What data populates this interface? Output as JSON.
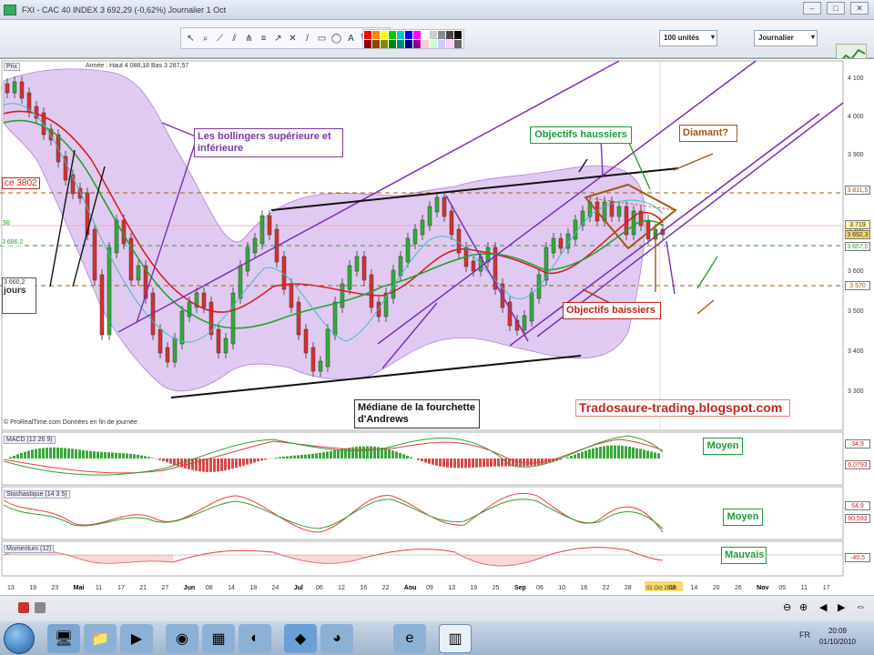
{
  "window": {
    "title": "FXI - CAC 40 INDEX    3 692,29 (-0,62%)   Journalier  1 Oct"
  },
  "toolbar": {
    "quantity_select": "100 unités",
    "period_select": "Journalier",
    "palette_colors": [
      "#ff0000",
      "#ff8800",
      "#ffff00",
      "#00cc00",
      "#00cccc",
      "#0000ff",
      "#ff00ff",
      "#ffffff",
      "#cccccc",
      "#888888",
      "#444444",
      "#000000",
      "#880000",
      "#884400",
      "#888800",
      "#008800",
      "#008888",
      "#000088",
      "#880088",
      "#ffcccc",
      "#ccffcc",
      "#ccccff",
      "#ffccff",
      "#666666"
    ]
  },
  "price_panel": {
    "label": "Prix",
    "header": "Année : Haut 4 088,18  Bas 3 287,57",
    "right_axis": [
      "4 100",
      "4 000",
      "3 900",
      "3 800",
      "3 700",
      "3 600",
      "3 500",
      "3 400",
      "3 300"
    ],
    "price_tags": [
      "3 811,5",
      "3 719",
      "3 692,3",
      "3 657,0",
      "3 570"
    ],
    "left_tags": [
      "ce 3802",
      "3 686,2",
      "3 660,2",
      "jours",
      "36"
    ],
    "footer": "© ProRealTime.com  Données en fin de journée"
  },
  "annotations": {
    "bollinger": "Les bollingers supérieure et inférieure",
    "objectifs_haussiers": "Objectifs haussiers",
    "diamant": "Diamant?",
    "objectifs_baissiers": "Objectifs baissiers",
    "mediane": "Médiane de la fourchette d'Andrews",
    "blog": "Tradosaure-trading.blogspot.com"
  },
  "indicators": [
    {
      "name": "MACD (12 26 9)",
      "verdict": "Moyen",
      "tags": [
        "34,9",
        "6,0793"
      ]
    },
    {
      "name": "Stochastique (14 3 5)",
      "verdict": "Moyen",
      "tags": [
        "64,9",
        "60,593"
      ]
    },
    {
      "name": "Momentum (12)",
      "verdict": "Mauvais",
      "tags": [
        "-40,5"
      ]
    }
  ],
  "x_axis": {
    "labels": [
      "13",
      "19",
      "23",
      "Mai",
      "11",
      "17",
      "21",
      "27",
      "Jun",
      "08",
      "14",
      "18",
      "24",
      "Jul",
      "06",
      "12",
      "16",
      "22",
      "Aou",
      "09",
      "13",
      "19",
      "25",
      "Sep",
      "06",
      "10",
      "16",
      "22",
      "28",
      "01 Oct 2010",
      "08",
      "14",
      "20",
      "26",
      "Nov",
      "05",
      "11",
      "17"
    ],
    "current": "01 Oct 2010"
  },
  "taskbar": {
    "lang": "FR",
    "time": "20:09",
    "date": "01/10/2010"
  }
}
